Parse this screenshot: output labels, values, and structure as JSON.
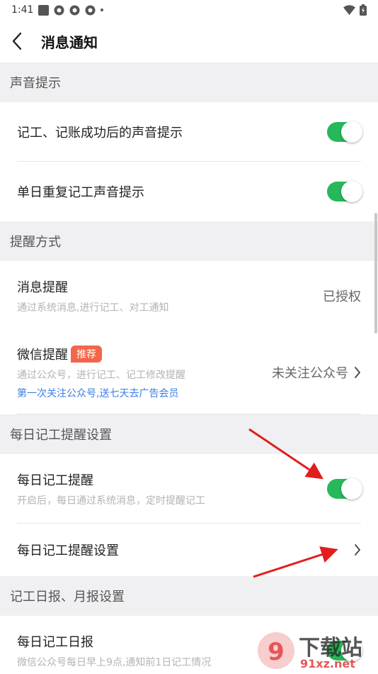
{
  "status": {
    "time": "1:41"
  },
  "header": {
    "title": "消息通知"
  },
  "sections": {
    "sound": {
      "title": "声音提示",
      "item1": "记工、记账成功后的声音提示",
      "item2": "单日重复记工声音提示"
    },
    "remind": {
      "title": "提醒方式",
      "msg_label": "消息提醒",
      "msg_sub": "通过系统消息,进行记工、对工通知",
      "msg_status": "已授权",
      "wx_label": "微信提醒",
      "wx_badge": "推荐",
      "wx_sub": "通过公众号，进行记工、记工修改提醒",
      "wx_promo": "第一次关注公众号,送七天去广告会员",
      "wx_status": "未关注公众号"
    },
    "daily": {
      "title": "每日记工提醒设置",
      "item1_label": "每日记工提醒",
      "item1_sub": "开启后，每日通过系统消息，定时提醒记工",
      "item2_label": "每日记工提醒设置"
    },
    "report": {
      "title": "记工日报、月报设置",
      "item1_label": "每日记工日报",
      "item1_sub": "微信公众号每日早上9点,通知前1日记工情况"
    }
  },
  "toggles": {
    "sound1": true,
    "sound2": true,
    "daily": true
  },
  "watermark": {
    "brand": "下载站",
    "site": "91xz.net"
  },
  "colors": {
    "toggle_on": "#26b85a",
    "badge": "#f2664b",
    "link": "#3a7ee6",
    "section_bg": "#f0f0f2"
  }
}
